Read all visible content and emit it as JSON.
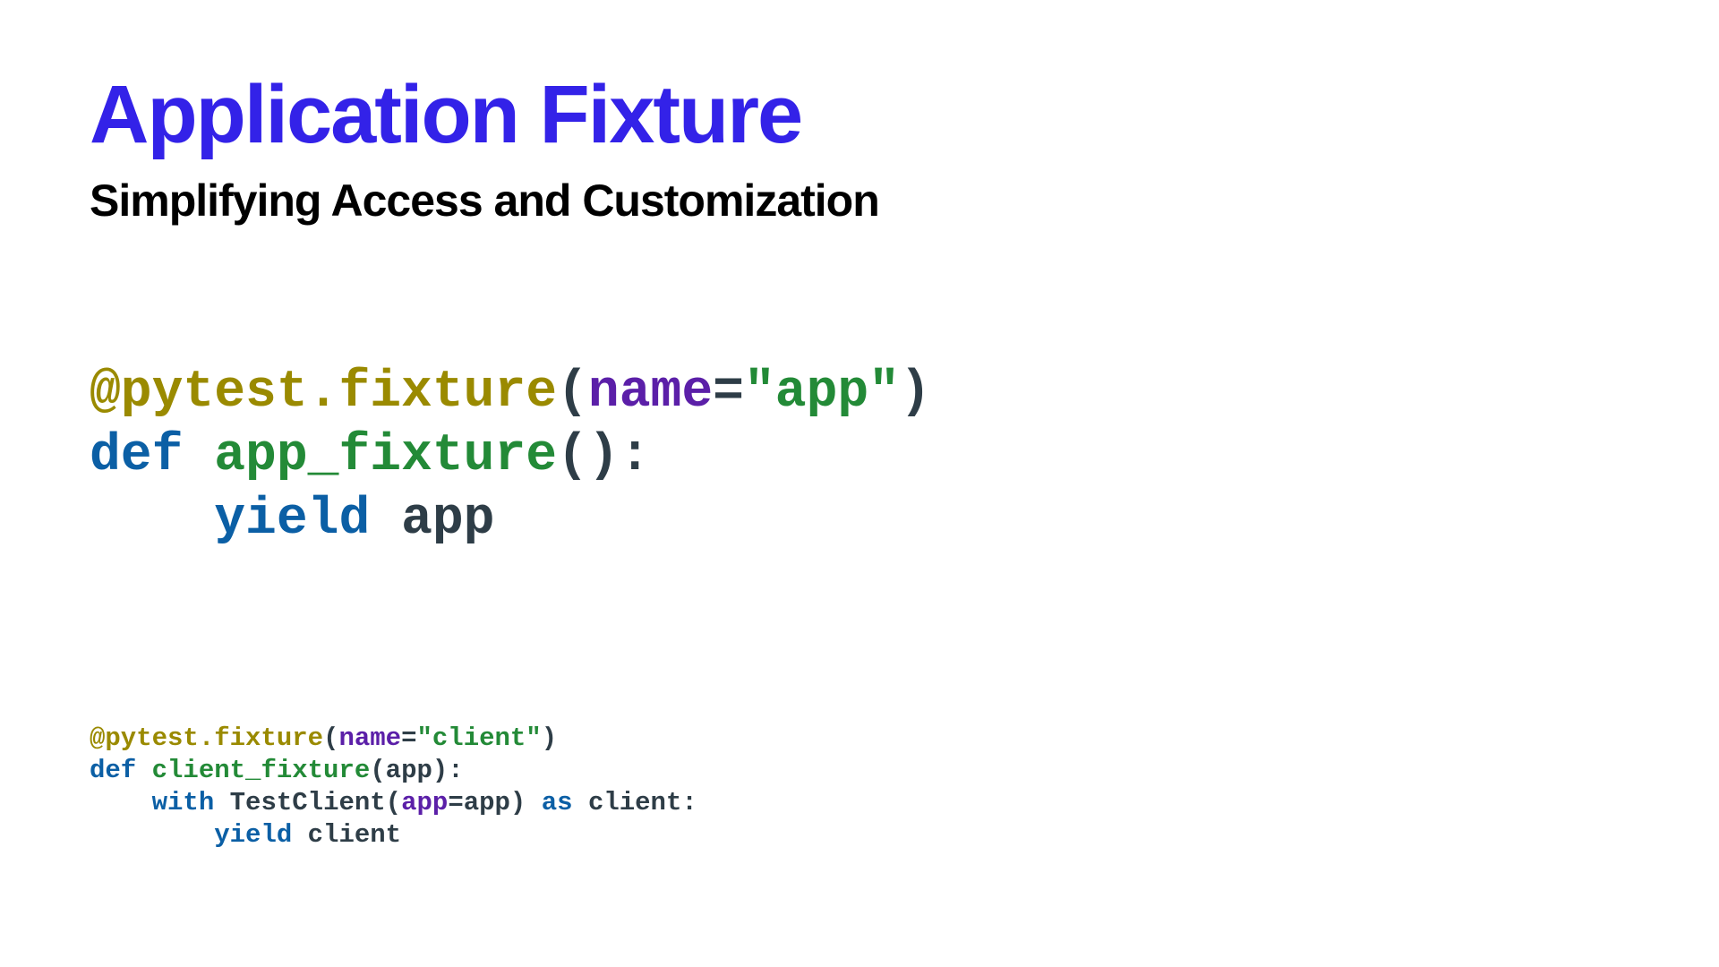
{
  "colors": {
    "title": "#3322e8",
    "black": "#222222",
    "decorator": "#9a8a00",
    "keyword": "#0b5fa5",
    "funcname": "#238a37",
    "param": "#5b1fa8",
    "string": "#238a37",
    "default": "#2e3d47"
  },
  "header": {
    "title": "Application Fixture",
    "subtitle": "Simplifying Access and Customization"
  },
  "code1": {
    "tokens": [
      {
        "t": "@pytest.fixture",
        "c": "decorator"
      },
      {
        "t": "(",
        "c": "default"
      },
      {
        "t": "name",
        "c": "param"
      },
      {
        "t": "=",
        "c": "default"
      },
      {
        "t": "\"app\"",
        "c": "string"
      },
      {
        "t": ")\n",
        "c": "default"
      },
      {
        "t": "def",
        "c": "keyword"
      },
      {
        "t": " ",
        "c": "default"
      },
      {
        "t": "app_fixture",
        "c": "funcname"
      },
      {
        "t": "():\n",
        "c": "default"
      },
      {
        "t": "    ",
        "c": "default"
      },
      {
        "t": "yield",
        "c": "keyword"
      },
      {
        "t": " app",
        "c": "default"
      }
    ]
  },
  "code2": {
    "tokens": [
      {
        "t": "@pytest.fixture",
        "c": "decorator"
      },
      {
        "t": "(",
        "c": "default"
      },
      {
        "t": "name",
        "c": "param"
      },
      {
        "t": "=",
        "c": "default"
      },
      {
        "t": "\"client\"",
        "c": "string"
      },
      {
        "t": ")\n",
        "c": "default"
      },
      {
        "t": "def",
        "c": "keyword"
      },
      {
        "t": " ",
        "c": "default"
      },
      {
        "t": "client_fixture",
        "c": "funcname"
      },
      {
        "t": "(app):\n",
        "c": "default"
      },
      {
        "t": "    ",
        "c": "default"
      },
      {
        "t": "with",
        "c": "keyword"
      },
      {
        "t": " TestClient(",
        "c": "default"
      },
      {
        "t": "app",
        "c": "param"
      },
      {
        "t": "=app) ",
        "c": "default"
      },
      {
        "t": "as",
        "c": "keyword"
      },
      {
        "t": " client:\n",
        "c": "default"
      },
      {
        "t": "        ",
        "c": "default"
      },
      {
        "t": "yield",
        "c": "keyword"
      },
      {
        "t": " client",
        "c": "default"
      }
    ]
  }
}
